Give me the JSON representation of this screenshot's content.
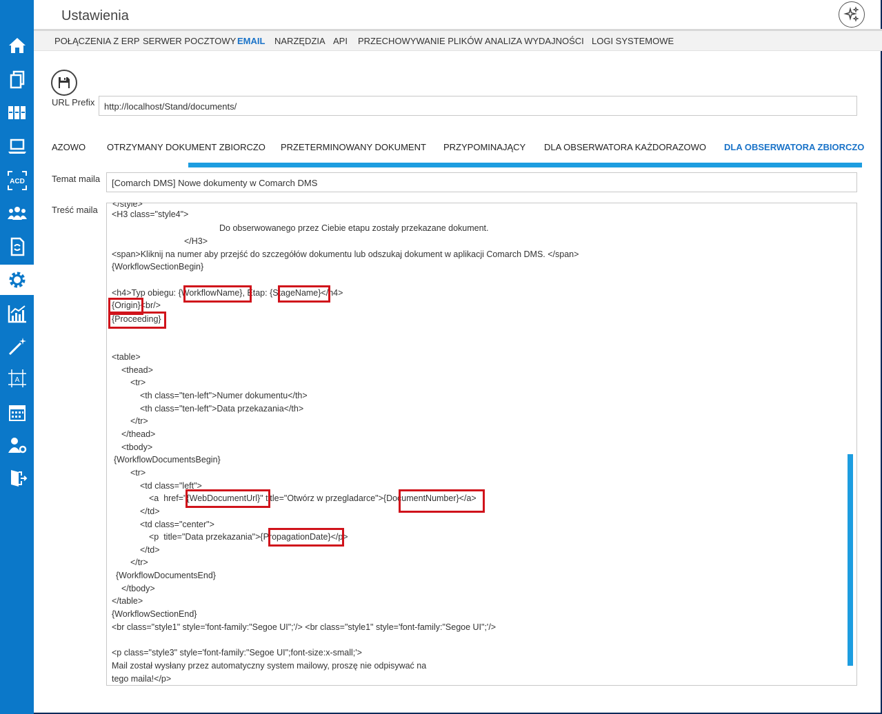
{
  "header": {
    "title": "Ustawienia"
  },
  "sidebar": {
    "items": [
      {
        "icon": "home-icon"
      },
      {
        "icon": "documents-icon"
      },
      {
        "icon": "binders-icon"
      },
      {
        "icon": "laptop-icon"
      },
      {
        "icon": "acd-icon",
        "label": "ACD"
      },
      {
        "icon": "users-icon"
      },
      {
        "icon": "document-sync-icon"
      },
      {
        "icon": "gear-icon",
        "active": true
      },
      {
        "icon": "analytics-icon"
      },
      {
        "icon": "magic-wand-icon"
      },
      {
        "icon": "designer-icon",
        "label": "A"
      },
      {
        "icon": "calendar-icon"
      },
      {
        "icon": "user-settings-icon"
      },
      {
        "icon": "logout-icon"
      }
    ]
  },
  "topnav": {
    "items": [
      {
        "label": "POŁĄCZENIA Z ERP"
      },
      {
        "label": "SERWER POCZTOWY"
      },
      {
        "label": "EMAIL",
        "active": true
      },
      {
        "label": "NARZĘDZIA"
      },
      {
        "label": "API"
      },
      {
        "label": "PRZECHOWYWANIE PLIKÓW"
      },
      {
        "label": "ANALIZA WYDAJNOŚCI"
      },
      {
        "label": "LOGI SYSTEMOWE"
      }
    ]
  },
  "form": {
    "url_prefix_label": "URL Prefix",
    "url_prefix_value": "http://localhost/Stand/documents/",
    "subject_label": "Temat maila",
    "subject_value": "[Comarch DMS] Nowe dokumenty w Comarch DMS",
    "body_label": "Treść maila"
  },
  "subtabs": {
    "items": [
      {
        "label": "AZOWO"
      },
      {
        "label": "OTRZYMANY DOKUMENT ZBIORCZO"
      },
      {
        "label": "PRZETERMINOWANY DOKUMENT"
      },
      {
        "label": "PRZYPOMINAJĄCY"
      },
      {
        "label": "DLA OBSERWATORA KAŻDORAZOWO"
      },
      {
        "label": "DLA OBSERWATORA ZBIORCZO",
        "active": true
      }
    ]
  },
  "mail_body": {
    "lines": [
      "</style>",
      "<H3 class=\"style4\">",
      "Do obserwowanego przez Ciebie etapu zostały przekazane dokument.",
      "</H3>",
      "<span>Kliknij na numer aby przejść do szczegółów dokumentu lub odszukaj dokument w aplikacji Comarch DMS. </span>",
      "{WorkflowSectionBegin}",
      "<h4>Typ obiegu: {WorkflowName}, Etap: {StageName}</h4>",
      "{Origin}<br/>",
      "{Proceeding}",
      "<table>",
      "<thead>",
      "<tr>",
      "<th class=\"ten-left\">Numer dokumentu</th>",
      "<th class=\"ten-left\">Data przekazania</th>",
      "</tr>",
      "</thead>",
      "<tbody>",
      "{WorkflowDocumentsBegin}",
      "<tr>",
      "<td class=\"left\">",
      "<a  href=\"{WebDocumentUrl}\" title=\"Otwórz w przegladarce\">{DocumentNumber}</a>",
      "</td>",
      "<td class=\"center\">",
      "<p  title=\"Data przekazania\">{PropagationDate}</p>",
      "</td>",
      "</tr>",
      "{WorkflowDocumentsEnd}",
      "</tbody>",
      "</table>",
      "{WorkflowSectionEnd}",
      "<br class=\"style1\" style='font-family:\"Segoe UI\";'/> <br class=\"style1\" style='font-family:\"Segoe UI\";'/>",
      "<p class=\"style3\" style='font-family:\"Segoe UI\";font-size:x-small;'>",
      "Mail został wysłany przez automatyczny system mailowy, proszę nie odpisywać na",
      "tego maila!</p>"
    ]
  },
  "colors": {
    "sidebar": "#0b78c9",
    "accent": "#1a73c8",
    "highlight": "#d0131b",
    "tab_bar": "#1d9de0"
  }
}
